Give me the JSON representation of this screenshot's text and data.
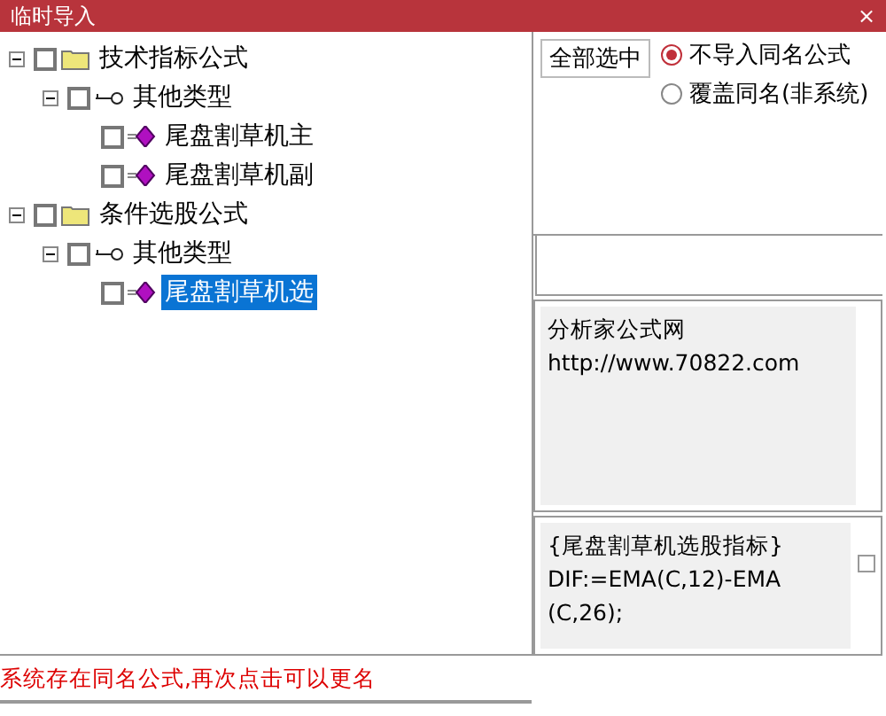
{
  "window": {
    "title": "临时导入",
    "close": "×"
  },
  "tree": [
    {
      "label": "技术指标公式",
      "kind": "folder",
      "expanded": true,
      "checked": false,
      "selected": false,
      "children": [
        {
          "label": "其他类型",
          "kind": "key",
          "expanded": true,
          "checked": false,
          "selected": false,
          "children": [
            {
              "label": "尾盘割草机主",
              "kind": "formula",
              "checked": false,
              "selected": false
            },
            {
              "label": "尾盘割草机副",
              "kind": "formula",
              "checked": false,
              "selected": false
            }
          ]
        }
      ]
    },
    {
      "label": "条件选股公式",
      "kind": "folder",
      "expanded": true,
      "checked": false,
      "selected": false,
      "children": [
        {
          "label": "其他类型",
          "kind": "key",
          "expanded": true,
          "checked": false,
          "selected": false,
          "children": [
            {
              "label": "尾盘割草机选",
              "kind": "formula",
              "checked": false,
              "selected": true
            }
          ]
        }
      ]
    }
  ],
  "select_all_button": "全部选中",
  "options": [
    {
      "label": "不导入同名公式",
      "selected": true
    },
    {
      "label": "覆盖同名(非系统)",
      "selected": false
    }
  ],
  "description": [
    "分析家公式网",
    "http://www.70822.com"
  ],
  "source": {
    "lines": [
      "{尾盘割草机选股指标}",
      "DIF:=EMA(C,12)-EMA",
      "(C,26);"
    ],
    "checked": false
  },
  "status": "系统存在同名公式,再次点击可以更名"
}
